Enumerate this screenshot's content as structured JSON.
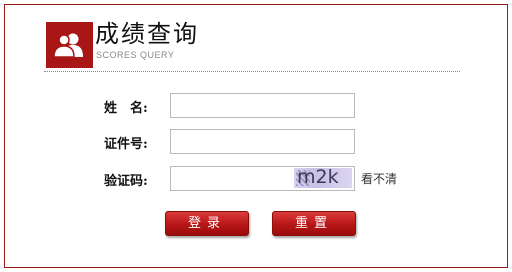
{
  "header": {
    "title": "成绩查询",
    "subtitle": "SCORES QUERY",
    "logo_icon": "users-icon"
  },
  "form": {
    "name_label": "姓　名:",
    "id_label": "证件号:",
    "code_label": "验证码:",
    "name_value": "",
    "id_value": "",
    "code_value": ""
  },
  "captcha": {
    "text": "m2k",
    "refresh_link": "看不清"
  },
  "buttons": {
    "login": "登录",
    "reset": "重置"
  },
  "colors": {
    "brand": "#a91616",
    "border": "#9b1b1b"
  }
}
